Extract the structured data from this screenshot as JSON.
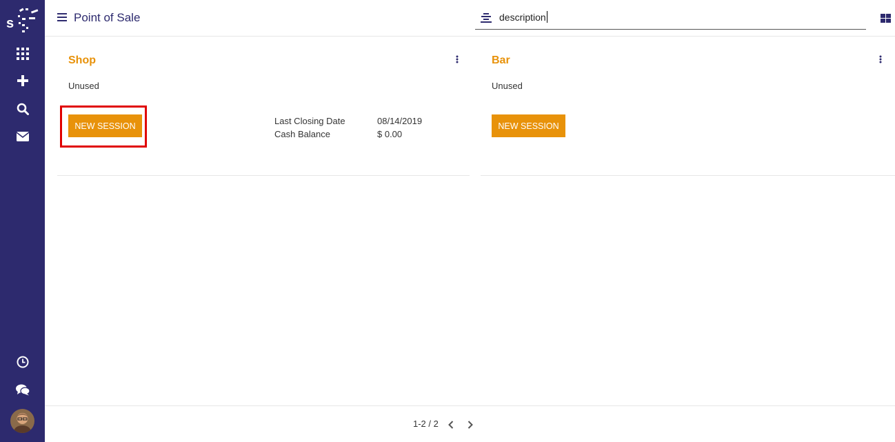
{
  "sidebar": {
    "items": [
      {
        "icon": "apps-grid-icon"
      },
      {
        "icon": "plus-icon"
      },
      {
        "icon": "search-icon"
      },
      {
        "icon": "envelope-icon"
      },
      {
        "icon": "clock-icon"
      },
      {
        "icon": "chat-icon"
      }
    ],
    "colors": {
      "background": "#2d2a6e"
    }
  },
  "header": {
    "title": "Point of Sale",
    "search": {
      "value": "description"
    }
  },
  "cards": [
    {
      "title": "Shop",
      "status": "Unused",
      "button_label": "NEW SESSION",
      "info": [
        {
          "label": "Last Closing Date",
          "value": "08/14/2019"
        },
        {
          "label": "Cash Balance",
          "value": "$ 0.00"
        }
      ]
    },
    {
      "title": "Bar",
      "status": "Unused",
      "button_label": "NEW SESSION"
    }
  ],
  "pager": {
    "text": "1-2 / 2"
  },
  "colors": {
    "accent": "#e8920a",
    "highlight": "#e00000",
    "title": "#2d2a6e"
  }
}
